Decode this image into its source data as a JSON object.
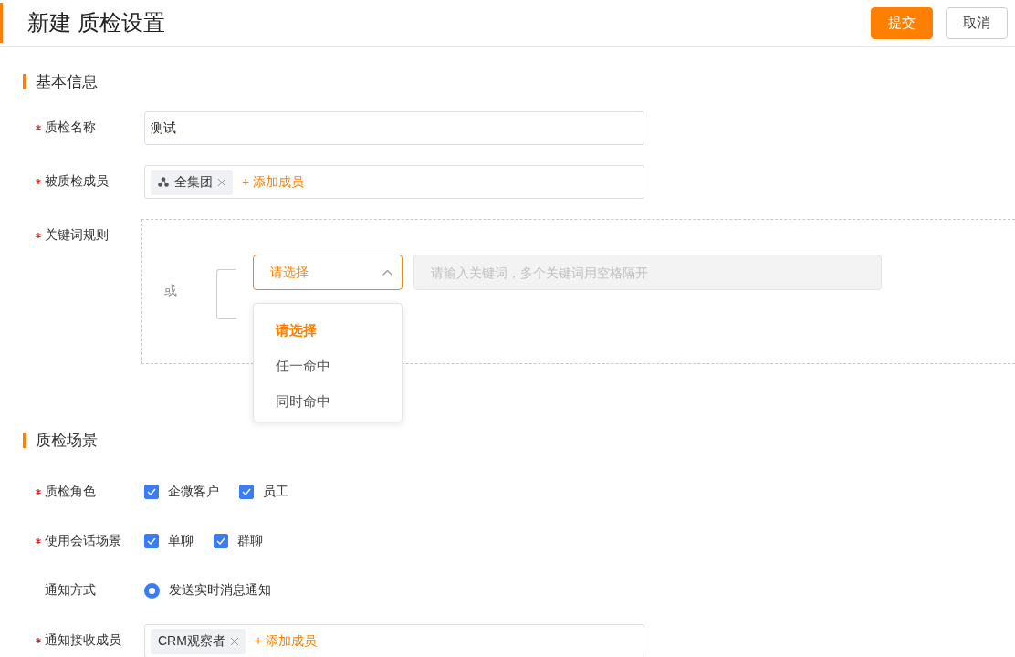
{
  "header": {
    "title": "新建 质检设置",
    "buttons": [
      {
        "label": "提交",
        "kind": "primary"
      },
      {
        "label": "取消",
        "kind": "default"
      }
    ]
  },
  "sections": [
    {
      "title": "基本信息",
      "fields": [
        {
          "kind": "text",
          "label": "质检名称",
          "required": true,
          "value": "测试"
        },
        {
          "kind": "members",
          "label": "被质检成员",
          "required": true,
          "tags": [
            {
              "label": "全集团",
              "kind": "group"
            }
          ],
          "add_label": "+ 添加成员"
        },
        {
          "kind": "keyword_rule",
          "label": "关键词规则",
          "required": true,
          "connector": "或",
          "select": {
            "value": "请选择",
            "expanded": true,
            "options": [
              {
                "label": "请选择",
                "selected": true
              },
              {
                "label": "任一命中",
                "selected": false
              },
              {
                "label": "同时命中",
                "selected": false
              }
            ]
          },
          "keyword_input": {
            "placeholder": "请输入关键词，多个关键词用空格隔开"
          }
        }
      ]
    },
    {
      "title": "质检场景",
      "fields": [
        {
          "kind": "checkboxes",
          "label": "质检角色",
          "required": true,
          "options": [
            {
              "label": "企微客户",
              "checked": true
            },
            {
              "label": "员工",
              "checked": true
            }
          ]
        },
        {
          "kind": "checkboxes",
          "label": "使用会话场景",
          "required": true,
          "options": [
            {
              "label": "单聊",
              "checked": true
            },
            {
              "label": "群聊",
              "checked": true
            }
          ]
        },
        {
          "kind": "radios",
          "label": "通知方式",
          "required": false,
          "options": [
            {
              "label": "发送实时消息通知",
              "selected": true
            }
          ]
        },
        {
          "kind": "members",
          "label": "通知接收成员",
          "required": true,
          "tags": [
            {
              "label": "CRM观察者",
              "kind": "plain"
            }
          ],
          "add_label": "+ 添加成员"
        }
      ]
    }
  ]
}
